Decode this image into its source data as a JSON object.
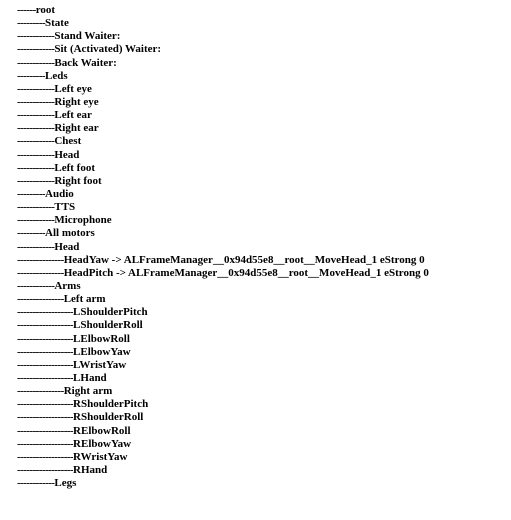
{
  "window": {
    "title": "Robot Module Tree",
    "background_color": "#ffffff",
    "text_color": "#000000"
  },
  "tree": {
    "indent_token": "-",
    "root_prefix_length": 6,
    "indent_step": 3,
    "lines": [
      {
        "prefix": "------",
        "label": "root"
      },
      {
        "prefix": "---------",
        "label": "State"
      },
      {
        "prefix": "------------",
        "label": "Stand Waiter:"
      },
      {
        "prefix": "------------",
        "label": "Sit (Activated) Waiter:"
      },
      {
        "prefix": "------------",
        "label": "Back Waiter:"
      },
      {
        "prefix": "---------",
        "label": "Leds"
      },
      {
        "prefix": "------------",
        "label": "Left eye"
      },
      {
        "prefix": "------------",
        "label": "Right eye"
      },
      {
        "prefix": "------------",
        "label": "Left ear"
      },
      {
        "prefix": "------------",
        "label": "Right ear"
      },
      {
        "prefix": "------------",
        "label": "Chest"
      },
      {
        "prefix": "------------",
        "label": "Head"
      },
      {
        "prefix": "------------",
        "label": "Left foot"
      },
      {
        "prefix": "------------",
        "label": "Right foot"
      },
      {
        "prefix": "---------",
        "label": "Audio"
      },
      {
        "prefix": "------------",
        "label": "TTS"
      },
      {
        "prefix": "------------",
        "label": "Microphone"
      },
      {
        "prefix": "---------",
        "label": "All motors"
      },
      {
        "prefix": "------------",
        "label": "Head"
      },
      {
        "prefix": "---------------",
        "label": "HeadYaw -> ALFrameManager__0x94d55e8__root__MoveHead_1 eStrong 0"
      },
      {
        "prefix": "---------------",
        "label": "HeadPitch -> ALFrameManager__0x94d55e8__root__MoveHead_1 eStrong 0"
      },
      {
        "prefix": "------------",
        "label": "Arms"
      },
      {
        "prefix": "---------------",
        "label": "Left arm"
      },
      {
        "prefix": "------------------",
        "label": "LShoulderPitch"
      },
      {
        "prefix": "------------------",
        "label": "LShoulderRoll"
      },
      {
        "prefix": "------------------",
        "label": "LElbowRoll"
      },
      {
        "prefix": "------------------",
        "label": "LElbowYaw"
      },
      {
        "prefix": "------------------",
        "label": "LWristYaw"
      },
      {
        "prefix": "------------------",
        "label": "LHand"
      },
      {
        "prefix": "---------------",
        "label": "Right arm"
      },
      {
        "prefix": "------------------",
        "label": "RShoulderPitch"
      },
      {
        "prefix": "------------------",
        "label": "RShoulderRoll"
      },
      {
        "prefix": "------------------",
        "label": "RElbowRoll"
      },
      {
        "prefix": "------------------",
        "label": "RElbowYaw"
      },
      {
        "prefix": "------------------",
        "label": "RWristYaw"
      },
      {
        "prefix": "------------------",
        "label": "RHand"
      },
      {
        "prefix": "------------",
        "label": "Legs"
      }
    ]
  }
}
